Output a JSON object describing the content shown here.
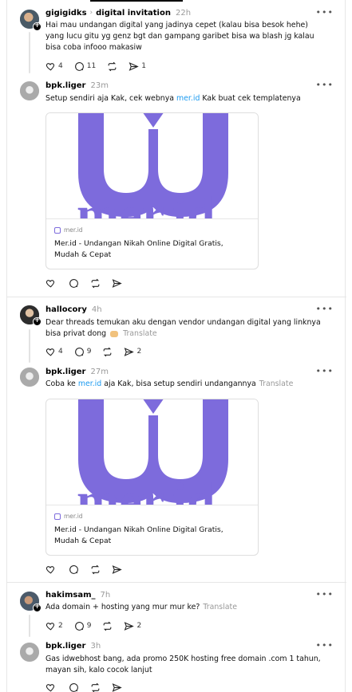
{
  "posts": [
    {
      "username": "gigigidks",
      "thread_topic": "digital invitation",
      "time": "22h",
      "text": "Hai mau undangan digital yang jadinya cepet (kalau bisa besok hehe) yang lucu gitu yg genz bgt dan gampang garibet bisa wa blash jg kalau bisa coba infooo makasiw",
      "likes": "4",
      "replies": "11",
      "reposts": "",
      "shares": "1"
    },
    {
      "username": "bpk.liger",
      "time": "23m",
      "text_before": "Setup sendiri aja Kak, cek webnya ",
      "link": "mer.id",
      "text_after": " Kak buat cek templatenya",
      "card_source": "mer.id",
      "card_title": "Mer.id - Undangan Nikah Online Digital Gratis, Mudah & Cepat"
    },
    {
      "username": "hallocory",
      "time": "4h",
      "text": "Dear threads temukan aku dengan vendor undangan digital yang linknya bisa privat dong",
      "translate": "Translate",
      "likes": "4",
      "replies": "9",
      "reposts": "",
      "shares": "2"
    },
    {
      "username": "bpk.liger",
      "time": "27m",
      "text_before": "Coba ke ",
      "link": "mer.id",
      "text_after": " aja Kak, bisa setup sendiri undangannya",
      "translate": "Translate",
      "card_source": "mer.id",
      "card_title": "Mer.id - Undangan Nikah Online Digital Gratis, Mudah & Cepat"
    },
    {
      "username": "hakimsam_",
      "time": "7h",
      "text": "Ada domain + hosting yang mur mur ke?",
      "translate": "Translate",
      "likes": "2",
      "replies": "9",
      "reposts": "",
      "shares": "2"
    },
    {
      "username": "bpk.liger",
      "time": "3h",
      "text": "Gas idwebhost bang, ada promo 250K hosting free domain .com 1 tahun, mayan sih, kalo cocok lanjut"
    }
  ],
  "icons": {
    "more": "more-icon",
    "heart": "heart-icon",
    "comment": "comment-icon",
    "repost": "repost-icon",
    "share": "share-icon"
  },
  "colors": {
    "link": "#1d9bf0",
    "logo": "#7d6bdc",
    "muted": "#999999"
  }
}
